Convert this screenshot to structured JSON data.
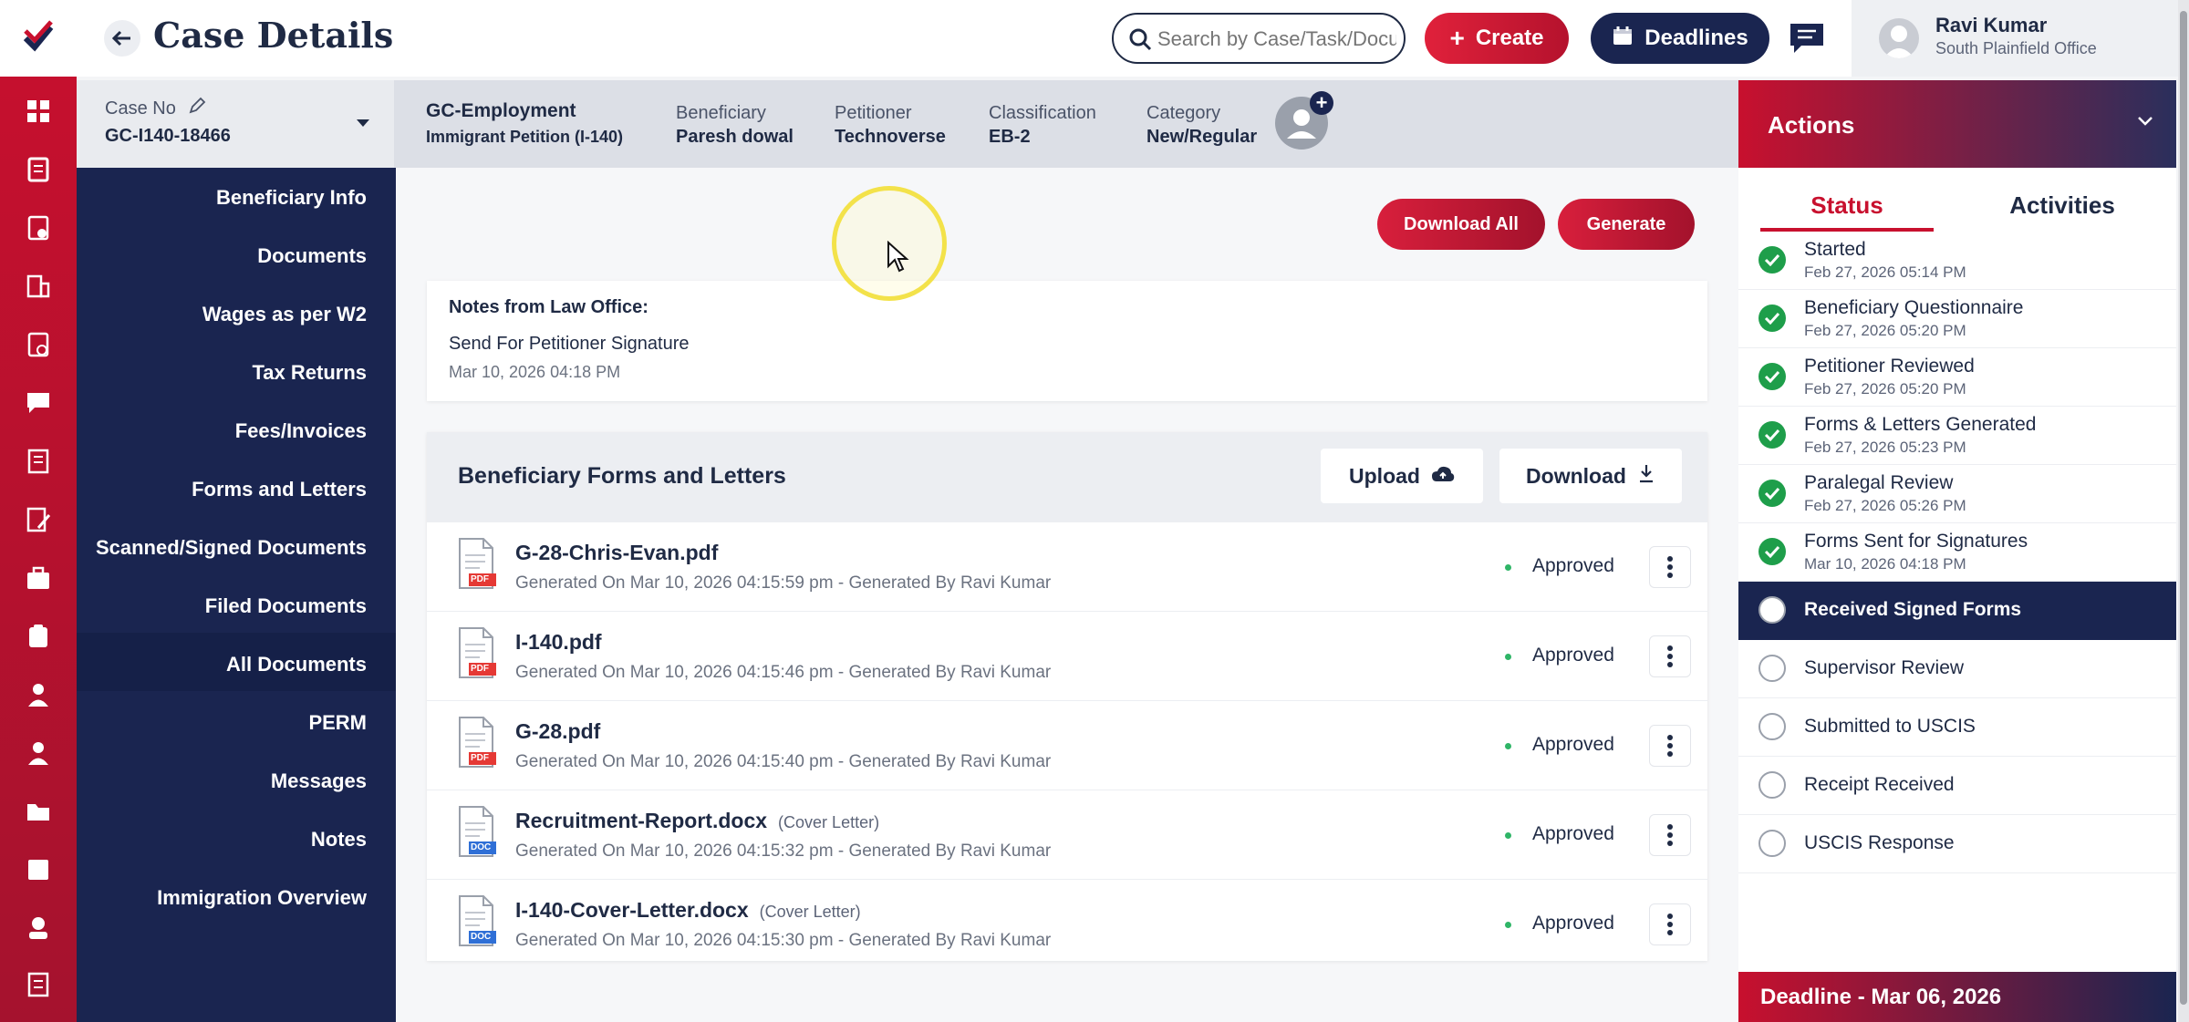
{
  "header": {
    "title": "Case Details",
    "search_placeholder": "Search by Case/Task/Document",
    "create_label": "Create",
    "deadlines_label": "Deadlines",
    "user_name": "Ravi Kumar",
    "user_office": "South Plainfield Office"
  },
  "case_info": {
    "case_no_label": "Case No",
    "case_no": "GC-I140-18466",
    "case_type": "GC-Employment",
    "case_subtype": "Immigrant Petition (I-140)",
    "beneficiary_label": "Beneficiary",
    "beneficiary": "Paresh dowal",
    "petitioner_label": "Petitioner",
    "petitioner": "Technoverse",
    "classification_label": "Classification",
    "classification": "EB-2",
    "category_label": "Category",
    "category": "New/Regular"
  },
  "left_nav": {
    "items": [
      {
        "label": "Beneficiary Info"
      },
      {
        "label": "Documents"
      },
      {
        "label": "Wages as per W2"
      },
      {
        "label": "Tax Returns"
      },
      {
        "label": "Fees/Invoices"
      },
      {
        "label": "Forms and Letters"
      },
      {
        "label": "Scanned/Signed Documents"
      },
      {
        "label": "Filed Documents"
      },
      {
        "label": "All Documents"
      },
      {
        "label": "PERM"
      },
      {
        "label": "Messages"
      },
      {
        "label": "Notes"
      },
      {
        "label": "Immigration Overview"
      }
    ],
    "active": "Forms and Letters"
  },
  "main": {
    "download_all_label": "Download All",
    "generate_label": "Generate",
    "notes": {
      "heading": "Notes from Law Office:",
      "text": "Send For Petitioner Signature",
      "date": "Mar 10, 2026 04:18 PM"
    },
    "forms": {
      "heading": "Beneficiary Forms and Letters",
      "upload_label": "Upload",
      "download_label": "Download",
      "rows": [
        {
          "name": "G-28-Chris-Evan.pdf",
          "tag": "",
          "type": "PDF",
          "meta": "Generated On Mar 10, 2026 04:15:59 pm - Generated By Ravi Kumar",
          "status": "Approved"
        },
        {
          "name": "I-140.pdf",
          "tag": "",
          "type": "PDF",
          "meta": "Generated On Mar 10, 2026 04:15:46 pm - Generated By Ravi Kumar",
          "status": "Approved"
        },
        {
          "name": "G-28.pdf",
          "tag": "",
          "type": "PDF",
          "meta": "Generated On Mar 10, 2026 04:15:40 pm - Generated By Ravi Kumar",
          "status": "Approved"
        },
        {
          "name": "Recruitment-Report.docx",
          "tag": "(Cover Letter)",
          "type": "DOC",
          "meta": "Generated On Mar 10, 2026 04:15:32 pm - Generated By Ravi Kumar",
          "status": "Approved"
        },
        {
          "name": "I-140-Cover-Letter.docx",
          "tag": "(Cover Letter)",
          "type": "DOC",
          "meta": "Generated On Mar 10, 2026 04:15:30 pm - Generated By Ravi Kumar",
          "status": "Approved"
        }
      ]
    }
  },
  "actions": {
    "title": "Actions",
    "tab_status": "Status",
    "tab_activities": "Activities",
    "steps": [
      {
        "name": "Started",
        "date": "Feb 27, 2026 05:14 PM",
        "state": "done"
      },
      {
        "name": "Beneficiary Questionnaire",
        "date": "Feb 27, 2026 05:20 PM",
        "state": "done"
      },
      {
        "name": "Petitioner Reviewed",
        "date": "Feb 27, 2026 05:20 PM",
        "state": "done"
      },
      {
        "name": "Forms & Letters Generated",
        "date": "Feb 27, 2026 05:23 PM",
        "state": "done"
      },
      {
        "name": "Paralegal Review",
        "date": "Feb 27, 2026 05:26 PM",
        "state": "done"
      },
      {
        "name": "Forms Sent for Signatures",
        "date": "Mar 10, 2026 04:18 PM",
        "state": "done"
      },
      {
        "name": "Received Signed Forms",
        "date": "",
        "state": "current"
      },
      {
        "name": "Supervisor Review",
        "date": "",
        "state": "pending"
      },
      {
        "name": "Submitted to USCIS",
        "date": "",
        "state": "pending"
      },
      {
        "name": "Receipt Received",
        "date": "",
        "state": "pending"
      },
      {
        "name": "USCIS Response",
        "date": "",
        "state": "pending"
      }
    ],
    "deadline": "Deadline - Mar 06, 2026"
  },
  "colors": {
    "brand_red": "#c8102e",
    "navy": "#1a2550",
    "success": "#1e9e4a"
  },
  "icons": [
    "logo-icon",
    "dashboard-icon",
    "back-arrow-icon",
    "search-icon",
    "plus-icon",
    "calendar-icon",
    "chat-icon",
    "user-avatar-icon",
    "edit-icon",
    "chevron-down-icon",
    "cloud-upload-icon",
    "download-icon",
    "kebab-icon",
    "check-icon",
    "pdf-file-icon",
    "doc-file-icon"
  ]
}
